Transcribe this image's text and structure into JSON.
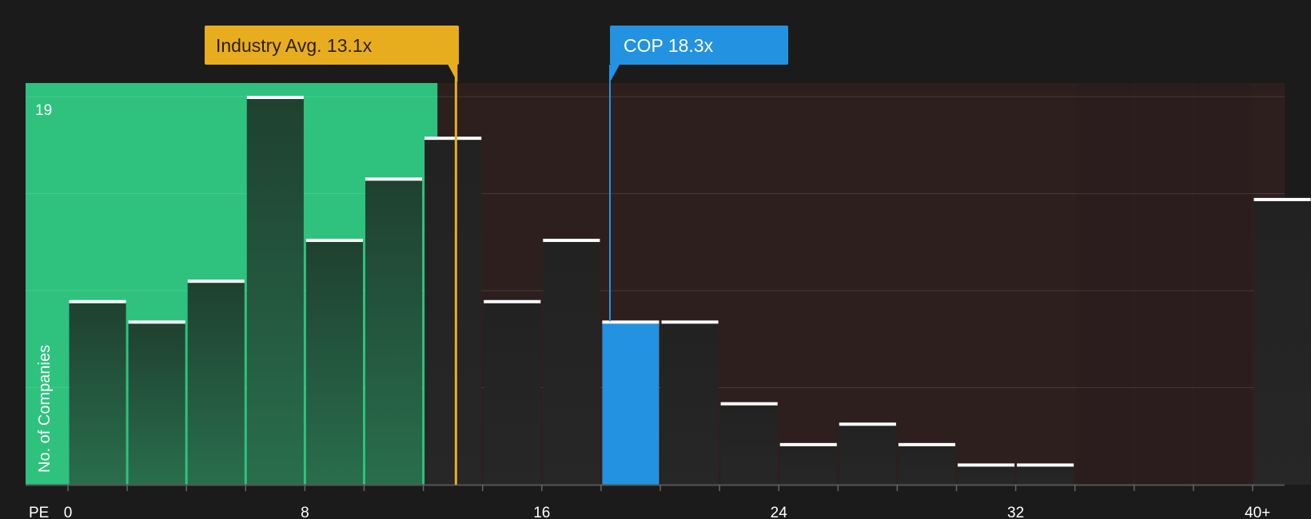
{
  "chart_data": {
    "type": "bar",
    "x_label": "PE",
    "y_label": "No. of Companies",
    "y_max_label": "19",
    "y_max": 19,
    "x_ticks": [
      "0",
      "8",
      "16",
      "24",
      "32",
      "40+"
    ],
    "bins": [
      {
        "x0": 0,
        "x1": 2,
        "value": 9
      },
      {
        "x0": 2,
        "x1": 4,
        "value": 8
      },
      {
        "x0": 4,
        "x1": 6,
        "value": 10
      },
      {
        "x0": 6,
        "x1": 8,
        "value": 19
      },
      {
        "x0": 8,
        "x1": 10,
        "value": 12
      },
      {
        "x0": 10,
        "x1": 12,
        "value": 15
      },
      {
        "x0": 12,
        "x1": 14,
        "value": 17
      },
      {
        "x0": 14,
        "x1": 16,
        "value": 9
      },
      {
        "x0": 16,
        "x1": 18,
        "value": 12
      },
      {
        "x0": 18,
        "x1": 20,
        "value": 8,
        "highlight": true
      },
      {
        "x0": 20,
        "x1": 22,
        "value": 8
      },
      {
        "x0": 22,
        "x1": 24,
        "value": 4
      },
      {
        "x0": 24,
        "x1": 26,
        "value": 2
      },
      {
        "x0": 26,
        "x1": 28,
        "value": 3
      },
      {
        "x0": 28,
        "x1": 30,
        "value": 2
      },
      {
        "x0": 30,
        "x1": 32,
        "value": 1
      },
      {
        "x0": 32,
        "x1": 34,
        "value": 1
      },
      {
        "x0": 34,
        "x1": 36,
        "value": 0
      },
      {
        "x0": 36,
        "x1": 38,
        "value": 0
      },
      {
        "x0": 38,
        "x1": 40,
        "value": 0
      },
      {
        "x0": 40,
        "x1": 42,
        "value": 14
      }
    ],
    "markers": {
      "industry": {
        "label": "Industry Avg. 13.1x",
        "value": 13.1
      },
      "company": {
        "label": "COP 18.3x",
        "value": 18.3
      }
    },
    "colors": {
      "background": "#1b1b1b",
      "undervalued_zone": "#2ec27e",
      "overvalued_zone": "#2e1f1f",
      "industry": "#e8ad1f",
      "company": "#2392e0",
      "bar_top": "#ffffff"
    }
  }
}
